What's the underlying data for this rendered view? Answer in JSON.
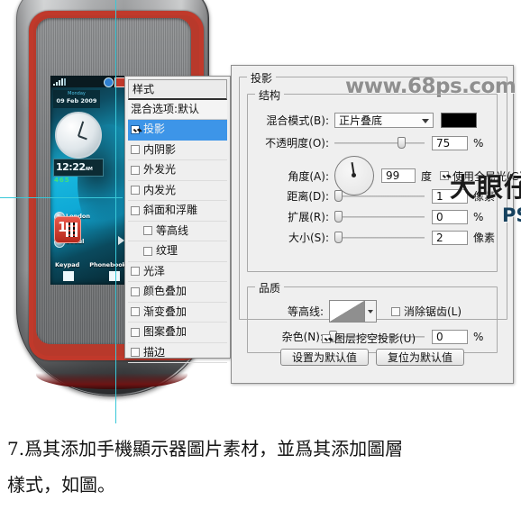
{
  "device": {
    "name": "phone-mockup",
    "lcd": {
      "weekday": "Monday",
      "date": "09 Feb 2009",
      "time": "12:22",
      "ampm": "AM",
      "green_text": "465",
      "cities": [
        {
          "name": "London"
        },
        {
          "name": "Seoul"
        }
      ],
      "app_badge_number": "1",
      "softkey_left": "Keypad",
      "softkey_right": "Phonebook"
    }
  },
  "styles_panel": {
    "title": "样式",
    "blending_options": "混合选项:默认",
    "items": [
      {
        "label": "投影",
        "checked": true,
        "selected": true,
        "indent": false
      },
      {
        "label": "内阴影",
        "checked": false,
        "selected": false,
        "indent": false
      },
      {
        "label": "外发光",
        "checked": false,
        "selected": false,
        "indent": false
      },
      {
        "label": "内发光",
        "checked": false,
        "selected": false,
        "indent": false
      },
      {
        "label": "斜面和浮雕",
        "checked": false,
        "selected": false,
        "indent": false
      },
      {
        "label": "等高线",
        "checked": false,
        "selected": false,
        "indent": true
      },
      {
        "label": "纹理",
        "checked": false,
        "selected": false,
        "indent": true
      },
      {
        "label": "光泽",
        "checked": false,
        "selected": false,
        "indent": false
      },
      {
        "label": "颜色叠加",
        "checked": false,
        "selected": false,
        "indent": false
      },
      {
        "label": "渐变叠加",
        "checked": false,
        "selected": false,
        "indent": false
      },
      {
        "label": "图案叠加",
        "checked": false,
        "selected": false,
        "indent": false
      },
      {
        "label": "描边",
        "checked": false,
        "selected": false,
        "indent": false
      }
    ]
  },
  "options_panel": {
    "title": "投影",
    "structure": {
      "legend": "结构",
      "blend_mode_label": "混合模式(B):",
      "blend_mode_value": "正片叠底",
      "shadow_color": "#000000",
      "opacity_label": "不透明度(O):",
      "opacity_value": "75",
      "opacity_unit": "%",
      "angle_label": "角度(A):",
      "angle_value": "99",
      "angle_unit": "度",
      "global_light_label": "使用全局光(G)",
      "global_light_checked": true,
      "distance_label": "距离(D):",
      "distance_value": "1",
      "distance_unit": "像素",
      "spread_label": "扩展(R):",
      "spread_value": "0",
      "spread_unit": "%",
      "size_label": "大小(S):",
      "size_value": "2",
      "size_unit": "像素"
    },
    "quality": {
      "legend": "品质",
      "contour_label": "等高线:",
      "antialias_label": "消除锯齿(L)",
      "antialias_checked": false,
      "noise_label": "杂色(N):",
      "noise_value": "0",
      "noise_unit": "%"
    },
    "knockout_label": "图层挖空投影(U)",
    "knockout_checked": true,
    "set_default_button": "设置为默认值",
    "reset_default_button": "复位为默认值"
  },
  "watermarks": {
    "site": "www.68ps.com",
    "author": "大眼仔~旭",
    "tutorial": "PS教程"
  },
  "caption": {
    "line1": "7.爲其添加手機顯示器圖片素材，並爲其添加圖層",
    "line2": "樣式，如圖。"
  },
  "colors": {
    "dialog_bg": "#efefef",
    "selection_blue": "#3d95e8",
    "bezel_red": "#c0392b",
    "accent_guide": "#39c8d8"
  }
}
